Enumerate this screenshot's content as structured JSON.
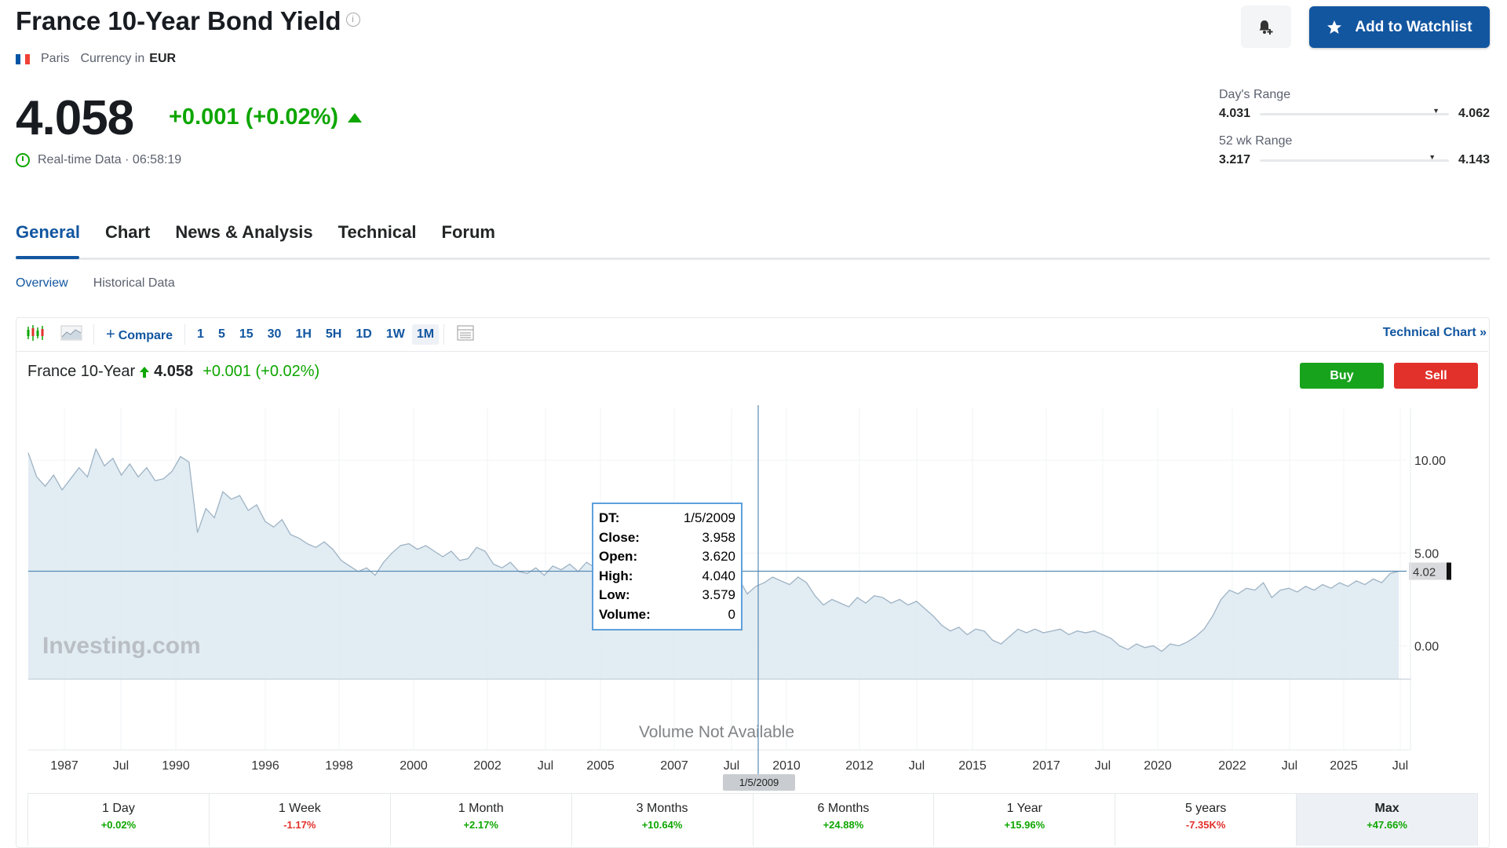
{
  "header": {
    "title": "France 10-Year Bond Yield",
    "info_glyph": "i",
    "exchange": "Paris",
    "currency_label": "Currency in",
    "currency": "EUR",
    "price": "4.058",
    "change": "+0.001 (+0.02%)",
    "realtime": "Real-time Data · 06:58:19",
    "watchlist_label": "Add to Watchlist",
    "flag_colors": [
      "#0055a4",
      "#ffffff",
      "#ef4135"
    ]
  },
  "ranges": {
    "day": {
      "label": "Day's Range",
      "low": "4.031",
      "high": "4.062",
      "position": 0.93
    },
    "week52": {
      "label": "52 wk Range",
      "low": "3.217",
      "high": "4.143",
      "position": 0.91
    }
  },
  "tabs": [
    "General",
    "Chart",
    "News & Analysis",
    "Technical",
    "Forum"
  ],
  "active_tab": "General",
  "subtabs": [
    "Overview",
    "Historical Data"
  ],
  "toolbar": {
    "compare": "Compare",
    "intervals": [
      "1",
      "5",
      "15",
      "30",
      "1H",
      "5H",
      "1D",
      "1W",
      "1M"
    ],
    "active_interval": "1M",
    "technical_chart": "Technical Chart",
    "technical_chart_glyph": "»"
  },
  "chart_header": {
    "name": "France 10-Year",
    "price": "4.058",
    "change": "+0.001 (+0.02%)",
    "buy": "Buy",
    "sell": "Sell"
  },
  "tooltip": {
    "rows": [
      {
        "k": "DT:",
        "v": "1/5/2009"
      },
      {
        "k": "Close:",
        "v": "3.958"
      },
      {
        "k": "Open:",
        "v": "3.620"
      },
      {
        "k": "High:",
        "v": "4.040"
      },
      {
        "k": "Low:",
        "v": "3.579"
      },
      {
        "k": "Volume:",
        "v": "0"
      }
    ]
  },
  "volume_note": "Volume Not Available",
  "watermark": "Investing.com",
  "chart_data": {
    "type": "area",
    "y_ticks": [
      "10.00",
      "5.00",
      "0.00"
    ],
    "ylim": [
      -1.8,
      12.8
    ],
    "x_ticks": [
      "1987",
      "Jul",
      "1990",
      "1996",
      "1998",
      "2000",
      "2002",
      "Jul",
      "2005",
      "2007",
      "Jul",
      "2010",
      "2012",
      "Jul",
      "2015",
      "2017",
      "Jul",
      "2020",
      "2022",
      "Jul",
      "2025",
      "Jul"
    ],
    "current_label": "4.02",
    "current_value": 4.02,
    "crosshair_x_label": "1/5/2009",
    "series": [
      {
        "values": [
          10.4,
          9.1,
          8.6,
          9.2,
          8.4,
          9.0,
          9.6,
          9.1,
          10.6,
          9.7,
          10.1,
          9.2,
          9.8,
          9.1,
          9.6,
          8.9,
          9.0,
          9.4,
          10.2,
          9.9,
          6.1,
          7.4,
          6.9,
          8.3,
          7.9,
          8.1,
          7.3,
          7.6,
          6.7,
          6.4,
          6.8,
          6.0,
          5.8,
          5.5,
          5.3,
          5.6,
          5.2,
          4.6,
          4.3,
          4.0,
          4.2,
          3.8,
          4.5,
          5.0,
          5.4,
          5.5,
          5.2,
          5.4,
          5.1,
          4.8,
          5.1,
          4.6,
          4.7,
          5.3,
          5.1,
          4.4,
          4.2,
          4.5,
          4.0,
          3.9,
          4.2,
          3.8,
          4.3,
          4.1,
          4.4,
          4.0,
          4.5,
          4.2,
          4.5,
          4.1,
          3.6,
          3.8,
          4.0,
          4.3,
          3.9,
          4.2,
          3.7,
          4.6,
          4.0,
          3.96,
          3.8,
          3.7,
          3.5,
          3.2,
          3.6,
          2.8,
          3.2,
          3.4,
          3.7,
          3.5,
          3.3,
          3.7,
          3.4,
          2.7,
          2.2,
          2.5,
          2.3,
          2.1,
          2.6,
          2.3,
          2.7,
          2.6,
          2.3,
          2.5,
          2.2,
          2.4,
          2.0,
          1.6,
          1.1,
          0.8,
          1.0,
          0.6,
          0.9,
          0.8,
          0.3,
          0.1,
          0.5,
          0.9,
          0.7,
          0.9,
          0.7,
          0.8,
          0.9,
          0.6,
          0.8,
          0.7,
          0.8,
          0.6,
          0.4,
          0.0,
          -0.2,
          0.1,
          -0.1,
          0.0,
          -0.3,
          0.1,
          0.0,
          0.2,
          0.5,
          0.9,
          1.6,
          2.5,
          3.0,
          2.8,
          3.1,
          3.0,
          3.4,
          2.6,
          3.0,
          3.1,
          2.9,
          3.2,
          3.0,
          3.3,
          3.1,
          3.4,
          3.2,
          3.5,
          3.3,
          3.6,
          3.4,
          3.9,
          4.02
        ]
      }
    ]
  },
  "performance": [
    {
      "label": "1 Day",
      "value": "+0.02%",
      "dir": "pos"
    },
    {
      "label": "1 Week",
      "value": "-1.17%",
      "dir": "neg"
    },
    {
      "label": "1 Month",
      "value": "+2.17%",
      "dir": "pos"
    },
    {
      "label": "3 Months",
      "value": "+10.64%",
      "dir": "pos"
    },
    {
      "label": "6 Months",
      "value": "+24.88%",
      "dir": "pos"
    },
    {
      "label": "1 Year",
      "value": "+15.96%",
      "dir": "pos"
    },
    {
      "label": "5 years",
      "value": "-7.35K%",
      "dir": "neg"
    },
    {
      "label": "Max",
      "value": "+47.66%",
      "dir": "pos",
      "active": true
    }
  ],
  "colors": {
    "accent": "#1256a0",
    "up": "#0ea600",
    "down": "#e2302a",
    "area_fill": "#dde9f1",
    "area_line": "#9eb3c4",
    "price_line": "#5a8bb3"
  }
}
